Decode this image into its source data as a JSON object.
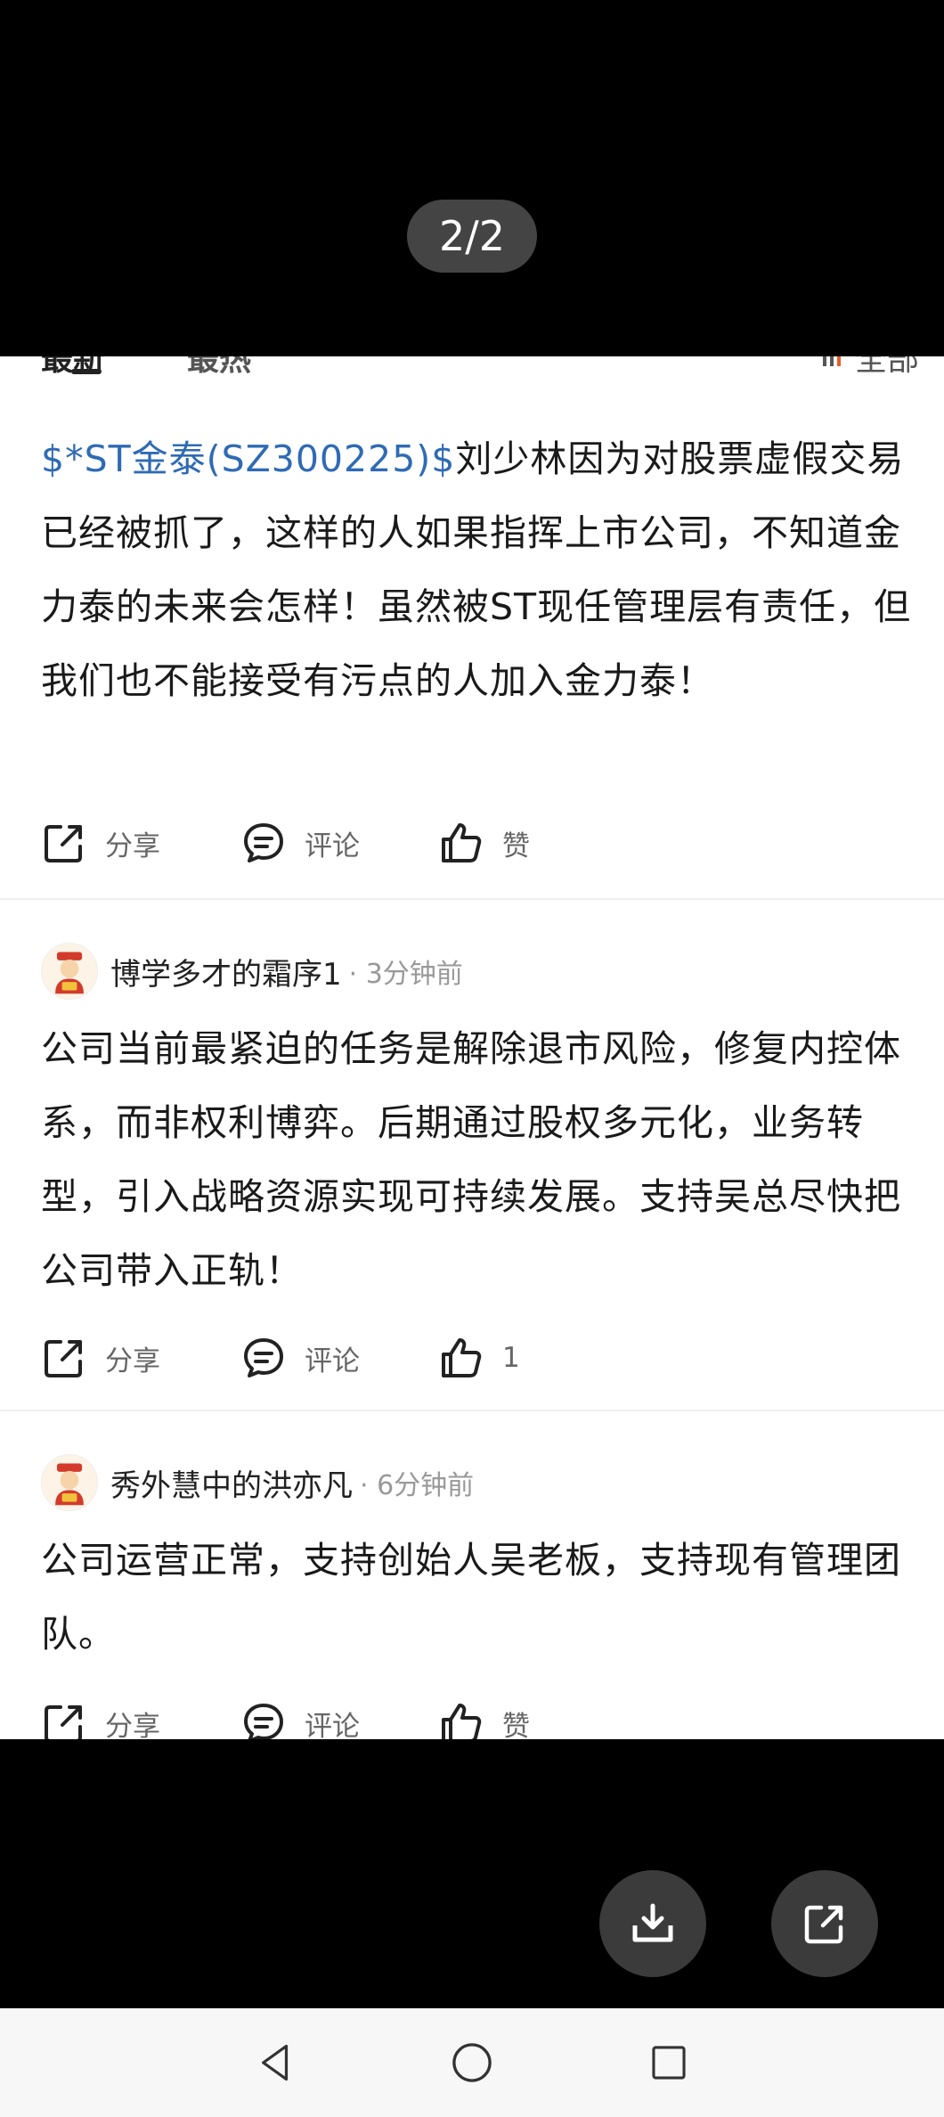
{
  "viewer": {
    "page_indicator": "2/2",
    "buttons": {
      "download_icon": "download-icon",
      "open_icon": "external-link-icon"
    }
  },
  "tabs": {
    "latest": "最新",
    "hot": "最热",
    "filter": "全部"
  },
  "posts": [
    {
      "stock_link": "$*ST金泰(SZ300225)$",
      "text": "刘少林因为对股票虚假交易已经被抓了，这样的人如果指挥上市公司，不知道金力泰的未来会怎样！虽然被ST现任管理层有责任，但我们也不能接受有污点的人加入金力泰！",
      "share": "分享",
      "comment": "评论",
      "like": "赞"
    },
    {
      "author": "博学多才的霜序1",
      "time": "· 3分钟前",
      "text": "公司当前最紧迫的任务是解除退市风险，修复内控体系，而非权利博弈。后期通过股权多元化，业务转型，引入战略资源实现可持续发展。支持吴总尽快把公司带入正轨！",
      "share": "分享",
      "comment": "评论",
      "like": "1"
    },
    {
      "author": "秀外慧中的洪亦凡",
      "time": "· 6分钟前",
      "text": "公司运营正常，支持创始人吴老板，支持现有管理团队。",
      "share": "分享",
      "comment": "评论",
      "like": "赞"
    }
  ],
  "colors": {
    "link": "#2e6bb4",
    "text": "#1a1a1a",
    "meta": "#999999",
    "background": "#000000"
  }
}
